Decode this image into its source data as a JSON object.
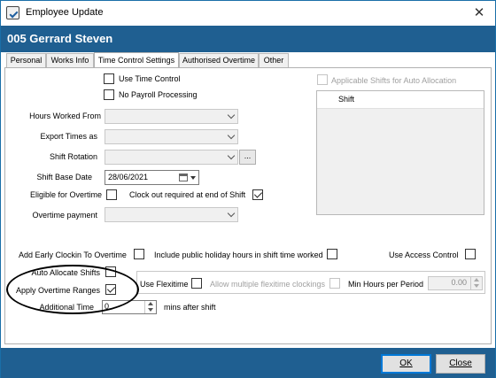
{
  "window": {
    "title": "Employee Update",
    "close_glyph": "✕"
  },
  "header": {
    "title": "005 Gerrard Steven"
  },
  "tabs": [
    {
      "label": "Personal"
    },
    {
      "label": "Works Info"
    },
    {
      "label": "Time Control Settings",
      "active": true
    },
    {
      "label": "Authorised Overtime"
    },
    {
      "label": "Other"
    }
  ],
  "form": {
    "use_time_control": {
      "label": "Use Time Control",
      "checked": false
    },
    "no_payroll_processing": {
      "label": "No Payroll Processing",
      "checked": false
    },
    "hours_worked_from": {
      "label": "Hours Worked From",
      "value": ""
    },
    "export_times_as": {
      "label": "Export Times as",
      "value": ""
    },
    "shift_rotation": {
      "label": "Shift Rotation",
      "value": "",
      "browse_label": "..."
    },
    "shift_base_date": {
      "label": "Shift Base Date",
      "value": "28/06/2021"
    },
    "eligible_for_overtime": {
      "label": "Eligible for Overtime",
      "checked": false
    },
    "clock_out_required": {
      "label": "Clock out required at end of Shift",
      "checked": true
    },
    "overtime_payment": {
      "label": "Overtime payment",
      "value": ""
    },
    "applicable_shifts": {
      "label": "Applicable Shifts for Auto Allocation",
      "checked": false,
      "column": "Shift"
    },
    "add_early_clockin": {
      "label": "Add Early Clockin To Overtime",
      "checked": false
    },
    "include_public_holiday": {
      "label": "Include public holiday hours in shift time worked",
      "checked": false
    },
    "use_access_control": {
      "label": "Use Access Control",
      "checked": false
    },
    "auto_allocate_shifts": {
      "label": "Auto Allocate Shifts",
      "checked": false
    },
    "apply_overtime_ranges": {
      "label": "Apply Overtime Ranges",
      "checked": true
    },
    "additional_time": {
      "label": "Additional Time",
      "value": "0",
      "suffix": "mins after shift"
    },
    "use_flexitime": {
      "label": "Use Flexitime",
      "checked": false
    },
    "allow_multiple_flexitime": {
      "label": "Allow multiple flexitime clockings",
      "checked": false
    },
    "min_hours_per_period": {
      "label": "Min Hours per Period",
      "value": "0.00"
    }
  },
  "footer": {
    "ok_label": "OK",
    "close_label": "Close"
  },
  "colors": {
    "header_bg": "#1f5f91",
    "default_button_border": "#0078d7"
  }
}
